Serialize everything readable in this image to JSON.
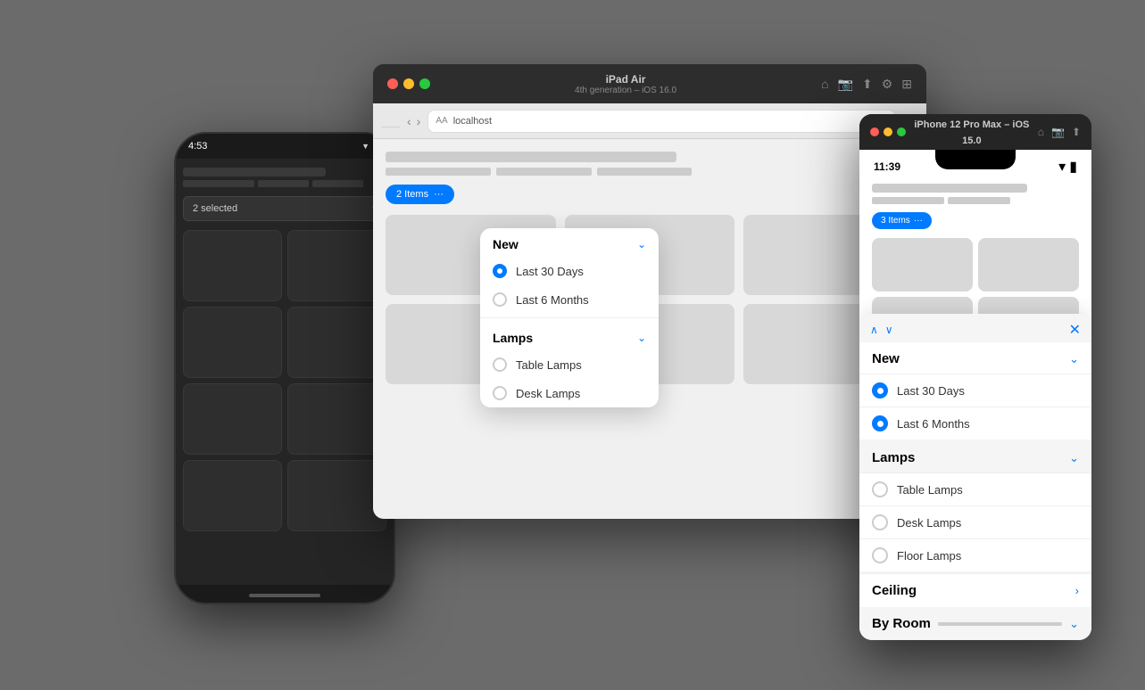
{
  "background": "#6b6b6b",
  "android": {
    "time": "4:53",
    "status_icons": [
      "□",
      "□",
      "S",
      "▼",
      "▼"
    ],
    "select_label": "2 selected",
    "select_chevron": "▾",
    "header_bar_width": "70%",
    "line_widths": [
      "30%",
      "25%",
      "25%"
    ]
  },
  "ipad": {
    "titlebar": {
      "device_name": "iPad Air",
      "device_sub": "4th generation – iOS 16.0"
    },
    "browser": {
      "url_aa": "AA",
      "url_text": "localhost",
      "more_icon": "···"
    },
    "filter_pill": {
      "label": "2 Items",
      "chevron": "···"
    },
    "dropdown": {
      "section1": {
        "title": "New",
        "chevron": "⌄",
        "items": [
          {
            "label": "Last 30 Days",
            "checked": true
          },
          {
            "label": "Last 6 Months",
            "checked": false
          }
        ]
      },
      "section2": {
        "title": "Lamps",
        "chevron": "⌄",
        "items": [
          {
            "label": "Table Lamps",
            "checked": false
          },
          {
            "label": "Desk Lamps",
            "checked": false
          }
        ]
      }
    }
  },
  "iphone": {
    "titlebar": {
      "title": "iPhone 12 Pro Max – iOS 15.0"
    },
    "time": "11:39",
    "filter_pill": {
      "label": "3 Items",
      "more": "···"
    },
    "panel": {
      "section1": {
        "title": "New",
        "chevron": "⌄",
        "items": [
          {
            "label": "Last 30 Days",
            "checked": true
          },
          {
            "label": "Last 6 Months",
            "checked": true
          }
        ]
      },
      "section2": {
        "title": "Lamps",
        "chevron": "⌄",
        "items": [
          {
            "label": "Table Lamps",
            "checked": false
          },
          {
            "label": "Desk Lamps",
            "checked": false
          },
          {
            "label": "Floor Lamps",
            "checked": false
          }
        ]
      },
      "ceiling": {
        "label": "Ceiling",
        "chevron": "›"
      },
      "byRoom": {
        "label": "By Room",
        "chevron": "⌄"
      }
    }
  }
}
